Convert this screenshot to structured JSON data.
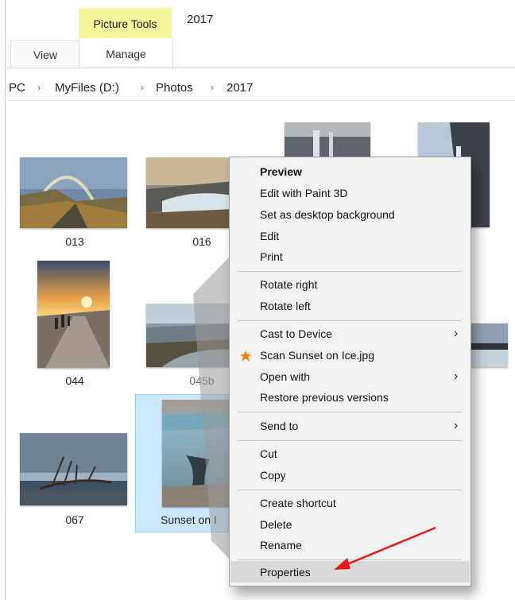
{
  "ribbon": {
    "context_header": "Picture Tools",
    "title": "2017",
    "tabs": [
      {
        "label": "View"
      },
      {
        "label": "Manage"
      }
    ]
  },
  "breadcrumb": [
    "PC",
    "MyFiles (D:)",
    "Photos",
    "2017"
  ],
  "thumbnails": [
    {
      "label": "013"
    },
    {
      "label": "016"
    },
    {
      "label": "044"
    },
    {
      "label": "045b"
    },
    {
      "label": "067"
    },
    {
      "label": "Sunset on I"
    }
  ],
  "context_menu": {
    "items": [
      {
        "label": "Preview",
        "bold": true
      },
      {
        "label": "Edit with Paint 3D"
      },
      {
        "label": "Set as desktop background"
      },
      {
        "label": "Edit"
      },
      {
        "label": "Print"
      },
      {
        "label": "Rotate right"
      },
      {
        "label": "Rotate left"
      },
      {
        "label": "Cast to Device",
        "submenu": true
      },
      {
        "label": "Scan Sunset on Ice.jpg",
        "icon": "avast-icon"
      },
      {
        "label": "Open with",
        "submenu": true
      },
      {
        "label": "Restore previous versions"
      },
      {
        "label": "Send to",
        "submenu": true
      },
      {
        "label": "Cut"
      },
      {
        "label": "Copy"
      },
      {
        "label": "Create shortcut"
      },
      {
        "label": "Delete"
      },
      {
        "label": "Rename"
      },
      {
        "label": "Properties",
        "highlighted": true
      }
    ]
  },
  "colors": {
    "context_tab": "#f4f59a",
    "selection": "#cce8ff",
    "annotation_arrow": "#e8191a",
    "avast_orange": "#ff7800"
  }
}
